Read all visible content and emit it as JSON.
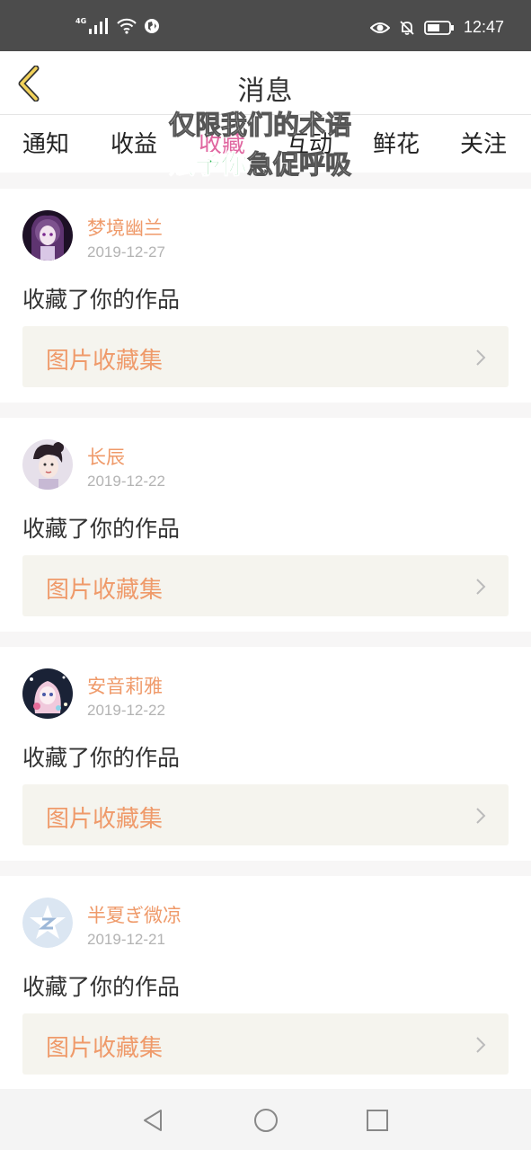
{
  "status_bar": {
    "network": "4G",
    "time": "12:47",
    "icons": [
      "signal-icon",
      "wifi-icon",
      "globe-icon",
      "eye-icon",
      "bell-off-icon",
      "battery-icon"
    ]
  },
  "header": {
    "title": "消息",
    "back_icon": "chevron-left-icon"
  },
  "tabs": [
    {
      "label": "通知",
      "active": false
    },
    {
      "label": "收益",
      "active": false
    },
    {
      "label": "收藏",
      "active": true
    },
    {
      "label": "互动",
      "active": false
    },
    {
      "label": "鲜花",
      "active": false
    },
    {
      "label": "关注",
      "active": false
    }
  ],
  "overlay": {
    "line1": "仅限我们的术语",
    "line2_highlight": "赋予你",
    "line2_rest": "急促呼吸"
  },
  "notifications": [
    {
      "username": "梦境幽兰",
      "date": "2019-12-27",
      "message": "收藏了你的作品",
      "link_label": "图片收藏集"
    },
    {
      "username": "长辰",
      "date": "2019-12-22",
      "message": "收藏了你的作品",
      "link_label": "图片收藏集"
    },
    {
      "username": "安音莉雅",
      "date": "2019-12-22",
      "message": "收藏了你的作品",
      "link_label": "图片收藏集"
    },
    {
      "username": "半夏ぎ微凉",
      "date": "2019-12-21",
      "message": "收藏了你的作品",
      "link_label": "图片收藏集"
    }
  ],
  "colors": {
    "accent": "#ef9a6a",
    "active_tab": "#e066a0",
    "status_bar": "#4c4c4c",
    "link_bg": "#f5f4ee"
  },
  "nav_bar": {
    "icons": [
      "back-triangle-icon",
      "home-circle-icon",
      "recents-square-icon"
    ]
  }
}
